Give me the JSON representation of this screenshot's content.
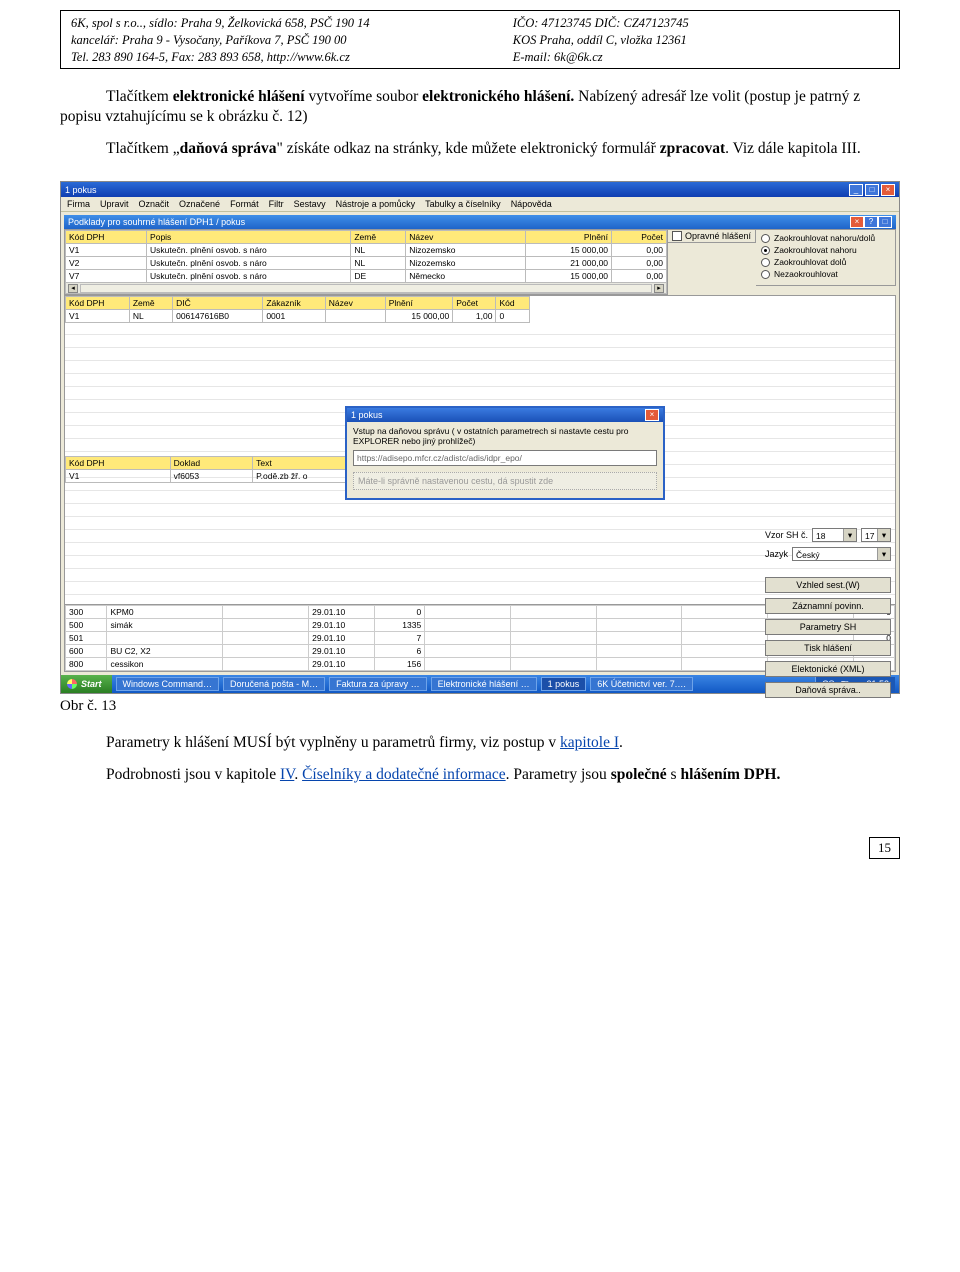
{
  "header": {
    "row1_left": "6K, spol s r.o.., sídlo: Praha 9, Želkovická 658, PSČ 190 14",
    "row1_right": "IČO: 47123745    DIČ: CZ47123745",
    "row2_left": "kancelář: Praha 9 - Vysočany, Paříkova 7, PSČ 190 00",
    "row2_right": "KOS Praha, oddíl C, vložka 12361",
    "row3_left": "Tel. 283 890 164-5,      Fax: 283 893 658,        http://www.6k.cz",
    "row3_right": "E-mail:  6k@6k.cz"
  },
  "para1": "Tlačítkem elektronické hlášení vytvoříme soubor elektronického hlášení. Nabízený adresář lze volit (postup je patrný z popisu vztahujícímu se k obrázku č. 12)",
  "para2": "Tlačítkem „daňová správa\" získáte odkaz na stránky, kde můžete elektronický formulář zpracovat. Viz dále kapitola III.",
  "appWindow": {
    "title": "1 pokus",
    "menus": [
      "Firma",
      "Upravit",
      "Označit",
      "Označené",
      "Formát",
      "Filtr",
      "Sestavy",
      "Nástroje a pomůcky",
      "Tabulky a číselníky",
      "Nápověda"
    ],
    "childTitle": "Podklady pro souhrné hlášení DPH1 / pokus",
    "topHeaders": [
      "Kód DPH",
      "Popis",
      "Země",
      "Název",
      "Plnění",
      "Počet"
    ],
    "topRows": [
      [
        "V1",
        "Uskutečn. plnění osvob. s náro",
        "NL",
        "Nizozemsko",
        "15 000,00",
        "0,00"
      ],
      [
        "V2",
        "Uskutečn. plnění osvob. s náro",
        "NL",
        "Nizozemsko",
        "21 000,00",
        "0,00"
      ],
      [
        "V7",
        "Uskutečn. plnění osvob. s náro",
        "DE",
        "Německo",
        "15 000,00",
        "0,00"
      ]
    ],
    "opravne": "Opravné hlášení",
    "rounding": {
      "label_ud": "Zaokrouhlovat nahoru/dolů",
      "label_n": "Zaokrouhlovat nahoru",
      "label_d": "Zaokrouhlovat dolů",
      "label_ne": "Nezaokrouhlovat",
      "selected": "Zaokrouhlovat nahoru"
    },
    "midHeaders": [
      "Kód DPH",
      "Země",
      "DIČ",
      "Zákazník",
      "Název",
      "Plnění",
      "Počet",
      "Kód"
    ],
    "midRow": [
      "V1",
      "NL",
      "006147616B0",
      "0001",
      "",
      "15 000,00",
      "1,00",
      "0"
    ],
    "midHeaders2": [
      "Kód DPH",
      "Doklad",
      "Text"
    ],
    "midRow2": [
      "V1",
      "vf6053",
      "P.odě.zb žř. o"
    ],
    "dialog": {
      "title": "1 pokus",
      "prompt": "Vstup na daňovou správu ( v ostatních parametrech si nastavte cestu pro EXPLORER nebo jiný prohlížeč)",
      "url": "https://adisepo.mfcr.cz/adistc/adis/idpr_epo/",
      "hint": "Máte-li správně nastavenou cestu, dá spustit zde",
      "close": "×"
    },
    "side": {
      "vzor_label": "Vzor SH č.",
      "vzor_val1": "18",
      "vzor_val2": "17",
      "jazyk_label": "Jazyk",
      "jazyk_val": "Český",
      "btn_vzhled": "Vzhled sest.(W)",
      "btn_zaznam": "Záznamní povinn.",
      "btn_param": "Parametry SH",
      "btn_tisk": "Tisk hlášení",
      "btn_xml": "Elektonické (XML)",
      "btn_dan": "Daňová správa.."
    },
    "lowerRows": [
      [
        "300",
        "KPM0",
        "",
        "29.01.10",
        "0",
        "",
        "",
        "",
        "",
        "",
        "0"
      ],
      [
        "500",
        "simák",
        "",
        "29.01.10",
        "1335",
        "",
        "",
        "",
        "",
        "",
        "0"
      ],
      [
        "501",
        "",
        "",
        "29.01.10",
        "7",
        "",
        "",
        "",
        "",
        "",
        "0"
      ],
      [
        "600",
        "BU C2, X2",
        "",
        "29.01.10",
        "6",
        "",
        "",
        "",
        "",
        "",
        "0"
      ],
      [
        "800",
        "cessikon",
        "",
        "29.01.10",
        "156",
        "",
        "",
        "",
        "",
        "",
        "0"
      ]
    ]
  },
  "taskbar": {
    "start": "Start",
    "items": [
      "Windows Command…",
      "Doručená pošta - M…",
      "Faktura za úpravy …",
      "Elektronické hlášení …",
      "1 pokus",
      "6K Účetnictví ver. 7.…"
    ],
    "tray": {
      "lang": "CS",
      "time": "21:53"
    }
  },
  "figure": "Obr č. 13",
  "para3_a": "Parametry k hlášení MUSÍ být vyplněny u parametrů firmy, viz postup v ",
  "para3_link": "kapitole I",
  "para3_b": ".",
  "para4_a": "Podrobnosti jsou v kapitole ",
  "para4_link1": "IV",
  "para4_mid": ". ",
  "para4_link2": "Číselníky a dodatečné informace",
  "para4_b": ". Parametry jsou společné s hlášením DPH.",
  "para4_bold": "společné",
  "page_number": "15"
}
